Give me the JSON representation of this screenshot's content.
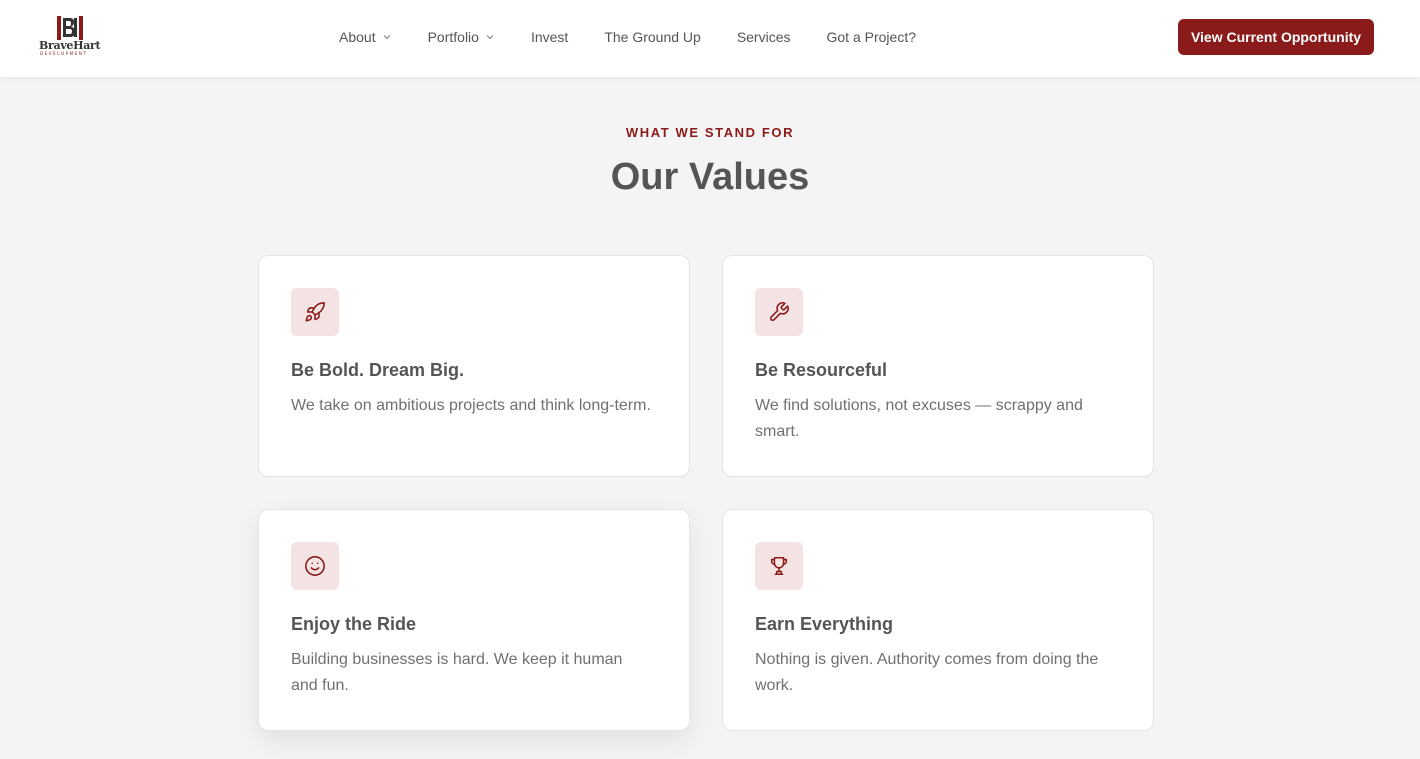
{
  "brand": {
    "logo_word": "BraveHart",
    "logo_sub": "DEVELOPMENT",
    "accent_color": "#8b1a1a"
  },
  "nav": {
    "items": [
      {
        "label": "About",
        "has_dropdown": true
      },
      {
        "label": "Portfolio",
        "has_dropdown": true
      },
      {
        "label": "Invest",
        "has_dropdown": false
      },
      {
        "label": "The Ground Up",
        "has_dropdown": false
      },
      {
        "label": "Services",
        "has_dropdown": false
      },
      {
        "label": "Got a Project?",
        "has_dropdown": false
      }
    ],
    "cta_label": "View Current Opportunity"
  },
  "values_section": {
    "eyebrow": "WHAT WE STAND FOR",
    "title": "Our Values",
    "cards": [
      {
        "icon": "rocket-icon",
        "title": "Be Bold. Dream Big.",
        "text": "We take on ambitious projects and think long-term."
      },
      {
        "icon": "wrench-icon",
        "title": "Be Resourceful",
        "text": "We find solutions, not excuses — scrappy and smart."
      },
      {
        "icon": "smiley-icon",
        "title": "Enjoy the Ride",
        "text": "Building businesses is hard. We keep it human and fun."
      },
      {
        "icon": "trophy-icon",
        "title": "Earn Everything",
        "text": "Nothing is given. Authority comes from doing the work."
      }
    ]
  }
}
